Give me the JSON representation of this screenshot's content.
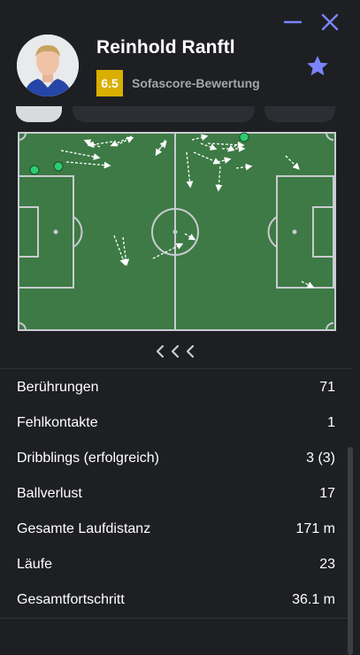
{
  "window": {
    "minimize_icon": "minimize-icon",
    "close_icon": "close-icon",
    "accent": "#7a84ff"
  },
  "player": {
    "name": "Reinhold Ranftl",
    "rating": "6.5",
    "rating_label": "Sofascore-Bewertung",
    "rating_color": "#d9af00",
    "favorite_icon": "star-icon"
  },
  "heatmap": {
    "pitch_color": "#3d7a45",
    "line_color": "#c9ccd1",
    "nav_icon": "chevron-left-icon"
  },
  "stats": [
    {
      "label": "Berührungen",
      "value": "71"
    },
    {
      "label": "Fehlkontakte",
      "value": "1"
    },
    {
      "label": "Dribblings (erfolgreich)",
      "value": "3 (3)"
    },
    {
      "label": "Ballverlust",
      "value": "17"
    },
    {
      "label": "Gesamte Laufdistanz",
      "value": "171 m"
    },
    {
      "label": "Läufe",
      "value": "23"
    },
    {
      "label": "Gesamtfortschritt",
      "value": "36.1 m"
    }
  ]
}
